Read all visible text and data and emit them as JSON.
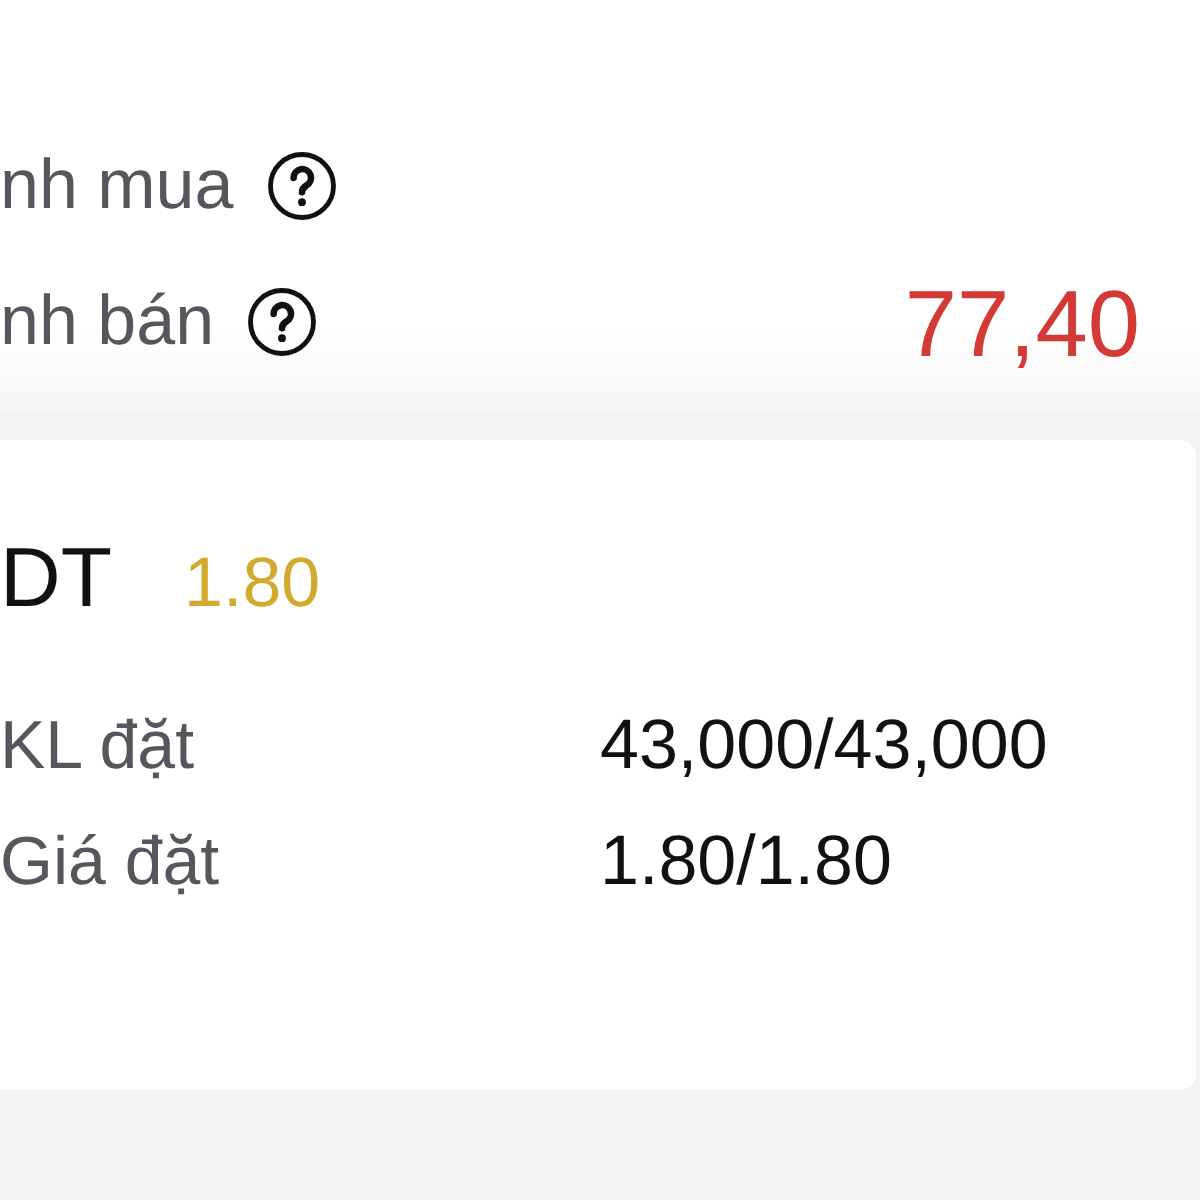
{
  "summary": {
    "rows": [
      {
        "label": "nh mua"
      },
      {
        "label": "nh bán",
        "value": "77,40"
      }
    ]
  },
  "order": {
    "symbol": "DT",
    "price": "1.80",
    "details": [
      {
        "label": "KL đặt",
        "value": "43,000/43,000"
      },
      {
        "label": "Giá đặt",
        "value": "1.80/1.80"
      }
    ]
  }
}
